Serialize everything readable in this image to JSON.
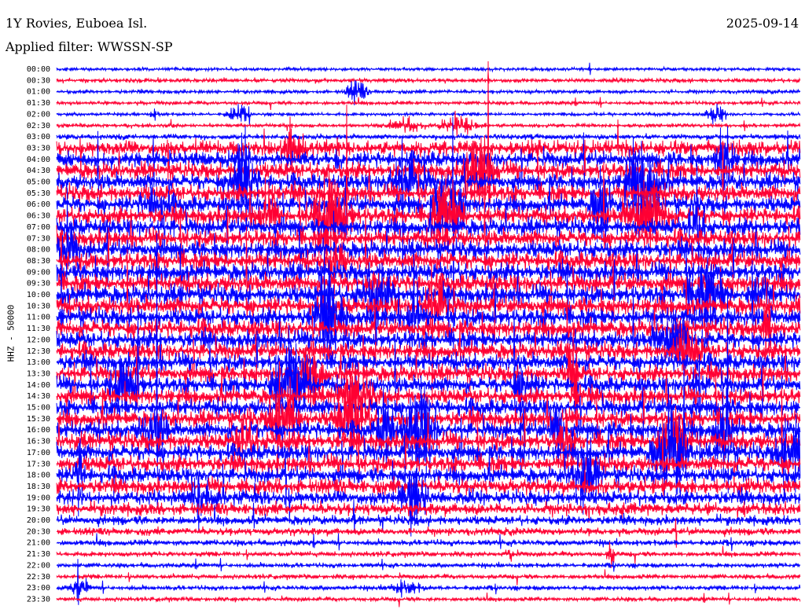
{
  "header": {
    "station": "1Y Rovies, Euboea Isl.",
    "date": "2025-09-14",
    "filter": "Applied filter: WWSSN-SP",
    "channel": "HHZ - 50000"
  },
  "colors": {
    "trace_a": "#0000ff",
    "trace_b": "#ff0033",
    "background": "#ffffff",
    "text": "#000000"
  },
  "chart_data": {
    "type": "line",
    "title": "1Y Rovies, Euboea Isl.",
    "subtitle": "Applied filter: WWSSN-SP",
    "ylabel": "HHZ - 50000",
    "xlabel": "",
    "grid": false,
    "legend": "none",
    "date": "2025-09-14",
    "row_labels": [
      "00:00",
      "00:30",
      "01:00",
      "01:30",
      "02:00",
      "02:30",
      "03:00",
      "03:30",
      "04:00",
      "04:30",
      "05:00",
      "05:30",
      "06:00",
      "06:30",
      "07:00",
      "07:30",
      "08:00",
      "08:30",
      "09:00",
      "09:30",
      "10:00",
      "10:30",
      "11:00",
      "11:30",
      "12:00",
      "12:30",
      "13:00",
      "13:30",
      "14:00",
      "14:30",
      "15:00",
      "15:30",
      "16:00",
      "16:30",
      "17:00",
      "17:30",
      "18:00",
      "18:30",
      "19:00",
      "19:30",
      "20:00",
      "20:30",
      "21:00",
      "21:30",
      "22:00",
      "22:30",
      "23:00",
      "23:30"
    ],
    "row_colors": [
      "trace_a",
      "trace_b"
    ],
    "relative_amplitude": [
      0.7,
      0.9,
      0.8,
      0.8,
      0.7,
      0.8,
      1.1,
      3.2,
      3.3,
      3.4,
      3.4,
      3.5,
      3.5,
      3.6,
      3.6,
      3.6,
      3.7,
      3.7,
      3.8,
      3.8,
      3.9,
      3.8,
      3.8,
      3.7,
      3.6,
      3.5,
      3.5,
      3.4,
      3.4,
      3.4,
      3.5,
      3.5,
      3.6,
      3.6,
      3.5,
      3.4,
      3.3,
      3.2,
      3.0,
      2.6,
      2.0,
      1.6,
      1.3,
      1.1,
      1.0,
      1.0,
      1.0,
      0.9
    ]
  }
}
